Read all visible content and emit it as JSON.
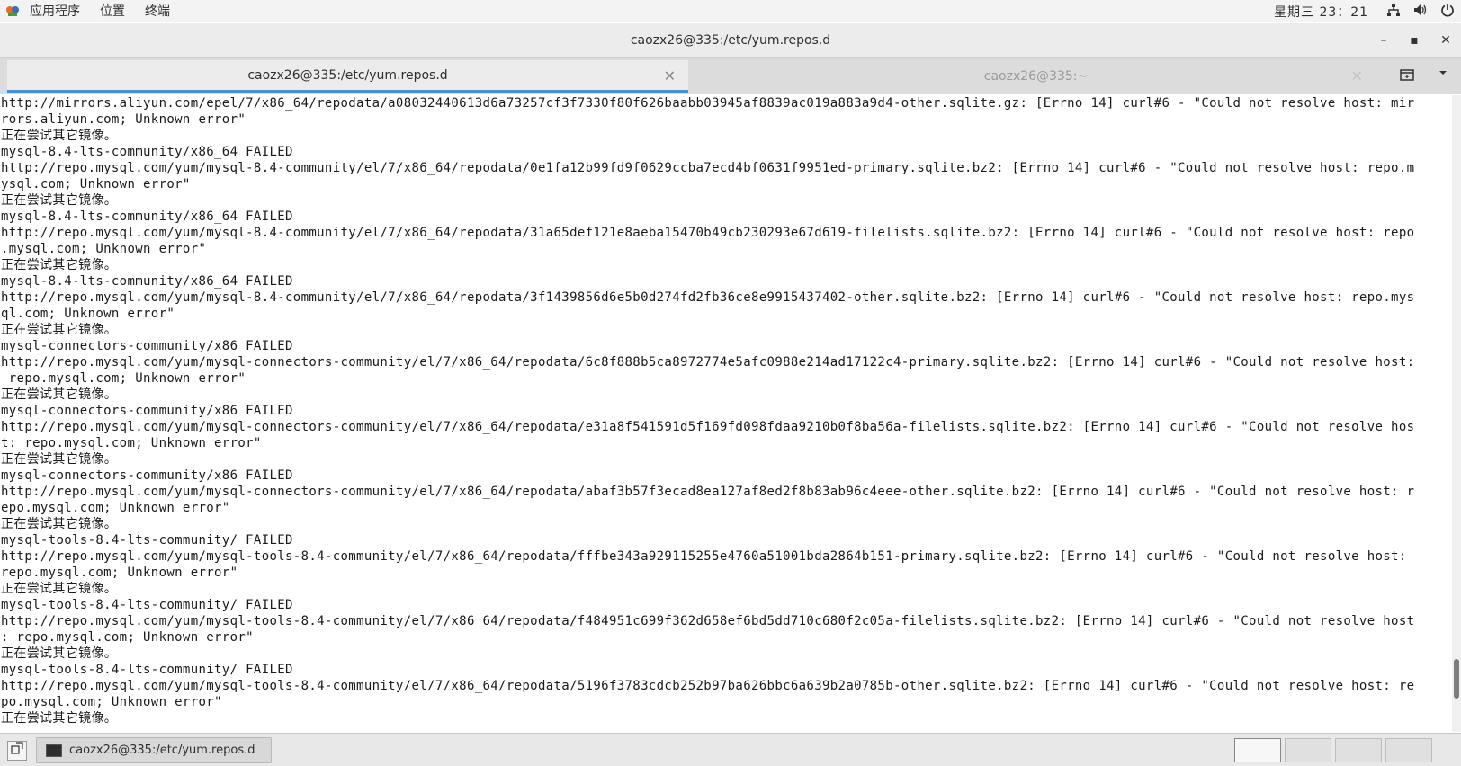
{
  "top_panel": {
    "apps_menu": "应用程序",
    "places_menu": "位置",
    "terminal_menu": "终端",
    "clock": "星期三 23：21"
  },
  "window": {
    "title": "caozx26@335:/etc/yum.repos.d",
    "minimize": "–",
    "maximize": "▪",
    "close": "✕"
  },
  "tabs": [
    {
      "label": "caozx26@335:/etc/yum.repos.d",
      "close": "✕",
      "active": true
    },
    {
      "label": "caozx26@335:~",
      "close": "✕",
      "active": false
    }
  ],
  "terminal": {
    "lines": [
      "http://mirrors.aliyun.com/epel/7/x86_64/repodata/a08032440613d6a73257cf3f7330f80f626baabb03945af8839ac019a883a9d4-other.sqlite.gz: [Errno 14] curl#6 - \"Could not resolve host: mir",
      "rors.aliyun.com; Unknown error\"",
      "正在尝试其它镜像。",
      "mysql-8.4-lts-community/x86_64 FAILED",
      "http://repo.mysql.com/yum/mysql-8.4-community/el/7/x86_64/repodata/0e1fa12b99fd9f0629ccba7ecd4bf0631f9951ed-primary.sqlite.bz2: [Errno 14] curl#6 - \"Could not resolve host: repo.m",
      "ysql.com; Unknown error\"",
      "正在尝试其它镜像。",
      "mysql-8.4-lts-community/x86_64 FAILED",
      "http://repo.mysql.com/yum/mysql-8.4-community/el/7/x86_64/repodata/31a65def121e8aeba15470b49cb230293e67d619-filelists.sqlite.bz2: [Errno 14] curl#6 - \"Could not resolve host: repo",
      ".mysql.com; Unknown error\"",
      "正在尝试其它镜像。",
      "mysql-8.4-lts-community/x86_64 FAILED",
      "http://repo.mysql.com/yum/mysql-8.4-community/el/7/x86_64/repodata/3f1439856d6e5b0d274fd2fb36ce8e9915437402-other.sqlite.bz2: [Errno 14] curl#6 - \"Could not resolve host: repo.mys",
      "ql.com; Unknown error\"",
      "正在尝试其它镜像。",
      "mysql-connectors-community/x86 FAILED",
      "http://repo.mysql.com/yum/mysql-connectors-community/el/7/x86_64/repodata/6c8f888b5ca8972774e5afc0988e214ad17122c4-primary.sqlite.bz2: [Errno 14] curl#6 - \"Could not resolve host:",
      " repo.mysql.com; Unknown error\"",
      "正在尝试其它镜像。",
      "mysql-connectors-community/x86 FAILED",
      "http://repo.mysql.com/yum/mysql-connectors-community/el/7/x86_64/repodata/e31a8f541591d5f169fd098fdaa9210b0f8ba56a-filelists.sqlite.bz2: [Errno 14] curl#6 - \"Could not resolve hos",
      "t: repo.mysql.com; Unknown error\"",
      "正在尝试其它镜像。",
      "mysql-connectors-community/x86 FAILED",
      "http://repo.mysql.com/yum/mysql-connectors-community/el/7/x86_64/repodata/abaf3b57f3ecad8ea127af8ed2f8b83ab96c4eee-other.sqlite.bz2: [Errno 14] curl#6 - \"Could not resolve host: r",
      "epo.mysql.com; Unknown error\"",
      "正在尝试其它镜像。",
      "mysql-tools-8.4-lts-community/ FAILED",
      "http://repo.mysql.com/yum/mysql-tools-8.4-community/el/7/x86_64/repodata/fffbe343a929115255e4760a51001bda2864b151-primary.sqlite.bz2: [Errno 14] curl#6 - \"Could not resolve host:",
      "repo.mysql.com; Unknown error\"",
      "正在尝试其它镜像。",
      "mysql-tools-8.4-lts-community/ FAILED",
      "http://repo.mysql.com/yum/mysql-tools-8.4-community/el/7/x86_64/repodata/f484951c699f362d658ef6bd5dd710c680f2c05a-filelists.sqlite.bz2: [Errno 14] curl#6 - \"Could not resolve host",
      ": repo.mysql.com; Unknown error\"",
      "正在尝试其它镜像。",
      "mysql-tools-8.4-lts-community/ FAILED",
      "http://repo.mysql.com/yum/mysql-tools-8.4-community/el/7/x86_64/repodata/5196f3783cdcb252b97ba626bbc6a639b2a0785b-other.sqlite.bz2: [Errno 14] curl#6 - \"Could not resolve host: re",
      "po.mysql.com; Unknown error\"",
      "正在尝试其它镜像。"
    ]
  },
  "taskbar": {
    "task_label": "caozx26@335:/etc/yum.repos.d",
    "workspaces": 4,
    "active_workspace": 1
  },
  "icons": {
    "apps": "apps-icon",
    "network": "network-icon",
    "volume": "volume-icon",
    "power": "power-icon",
    "new_tab": "new-tab-icon",
    "tab_menu": "chevron-down-icon",
    "show_desktop": "show-desktop-icon",
    "terminal": "terminal-icon"
  },
  "colors": {
    "active_tab_underline": "#4a90d9",
    "terminal_bg": "#ffffff",
    "terminal_fg": "#1a1a1a"
  }
}
